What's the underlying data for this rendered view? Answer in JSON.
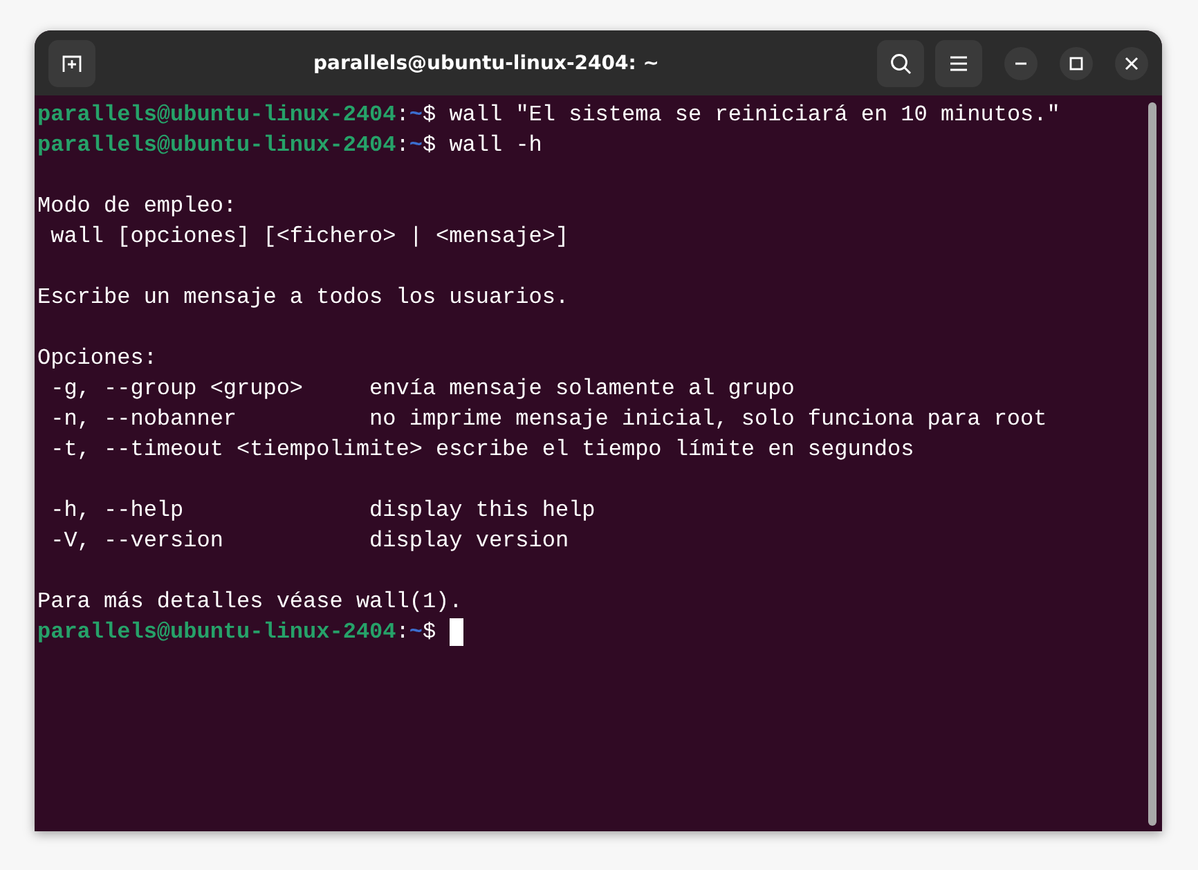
{
  "window": {
    "title": "parallels@ubuntu-linux-2404: ~"
  },
  "terminal": {
    "lines": [
      {
        "kind": "prompt",
        "user_host": "parallels@ubuntu-linux-2404",
        "separator": ":",
        "path": "~",
        "symbol": "$",
        "command": "wall \"El sistema se reiniciará en 10 minutos.\"",
        "cursor": false
      },
      {
        "kind": "prompt",
        "user_host": "parallels@ubuntu-linux-2404",
        "separator": ":",
        "path": "~",
        "symbol": "$",
        "command": "wall -h",
        "cursor": false
      },
      {
        "kind": "blank"
      },
      {
        "kind": "output",
        "text": "Modo de empleo:"
      },
      {
        "kind": "output",
        "text": " wall [opciones] [<fichero> | <mensaje>]"
      },
      {
        "kind": "blank"
      },
      {
        "kind": "output",
        "text": "Escribe un mensaje a todos los usuarios."
      },
      {
        "kind": "blank"
      },
      {
        "kind": "output",
        "text": "Opciones:"
      },
      {
        "kind": "output",
        "text": " -g, --group <grupo>     envía mensaje solamente al grupo"
      },
      {
        "kind": "output",
        "text": " -n, --nobanner          no imprime mensaje inicial, solo funciona para root"
      },
      {
        "kind": "output",
        "text": " -t, --timeout <tiempolimite> escribe el tiempo límite en segundos"
      },
      {
        "kind": "blank"
      },
      {
        "kind": "output",
        "text": " -h, --help              display this help"
      },
      {
        "kind": "output",
        "text": " -V, --version           display version"
      },
      {
        "kind": "blank"
      },
      {
        "kind": "output",
        "text": "Para más detalles véase wall(1)."
      },
      {
        "kind": "prompt",
        "user_host": "parallels@ubuntu-linux-2404",
        "separator": ":",
        "path": "~",
        "symbol": "$",
        "cursor": true
      }
    ]
  }
}
